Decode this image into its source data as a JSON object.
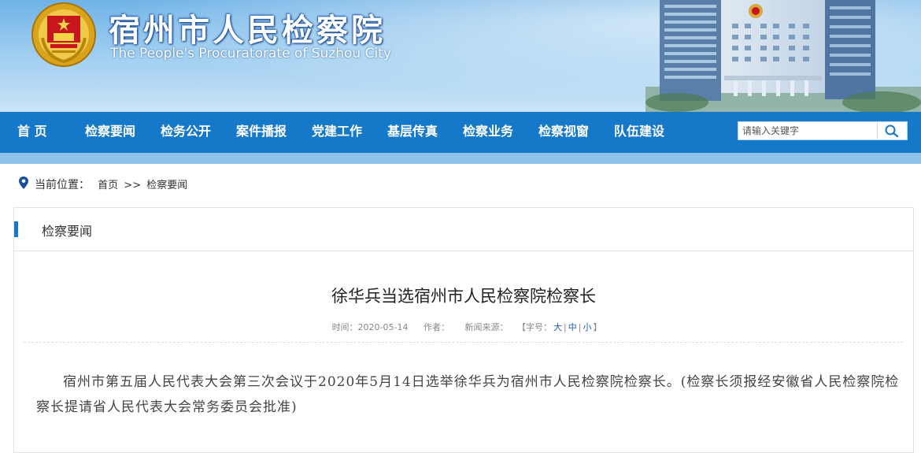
{
  "header": {
    "title": "宿州市人民检察院",
    "subtitle": "The People's Procuratorate of Suzhou City",
    "emblem_icon": "procuratorate-emblem"
  },
  "nav": {
    "items": [
      {
        "label": "首 页"
      },
      {
        "label": "检察要闻"
      },
      {
        "label": "检务公开"
      },
      {
        "label": "案件播报"
      },
      {
        "label": "党建工作"
      },
      {
        "label": "基层传真"
      },
      {
        "label": "检察业务"
      },
      {
        "label": "检察视窗"
      },
      {
        "label": "队伍建设"
      }
    ],
    "search_placeholder": "请输入关键字",
    "search_icon": "magnifier-icon"
  },
  "breadcrumb": {
    "label": "当前位置：",
    "home": "首页",
    "separator": ">>",
    "current": "检察要闻"
  },
  "panel": {
    "title": "检察要闻"
  },
  "article": {
    "title": "徐华兵当选宿州市人民检察院检察长",
    "time_label": "时间：2020-05-14",
    "author_label": "作者：",
    "source_label": "新闻来源：",
    "font_size_label": "【字号：",
    "size_large": "大",
    "size_medium": "中",
    "size_small": "小",
    "size_sep": "|",
    "size_close": "】",
    "body": "宿州市第五届人民代表大会第三次会议于2020年5月14日选举徐华兵为宿州市人民检察院检察长。(检察长须报经安徽省人民检察院检察长提请省人民代表大会常务委员会批准)"
  },
  "colors": {
    "nav_bg": "#1678c8",
    "nav_stripe": "#8fc2ea",
    "accent": "#1678c8",
    "link": "#1a5fb4"
  }
}
